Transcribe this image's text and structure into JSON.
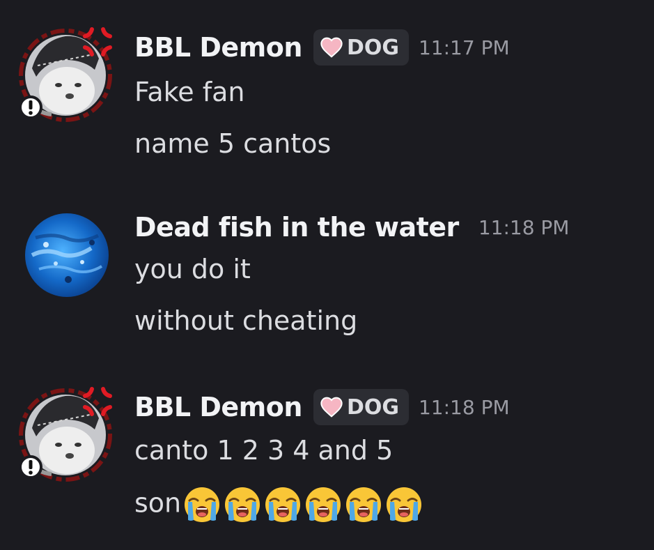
{
  "messages": [
    {
      "username": "BBL Demon",
      "tag": "DOG",
      "timestamp": "11:17 PM",
      "lines": [
        "Fake fan",
        "name 5 cantos"
      ],
      "avatar_icon": "seal-mugshot-avatar-with-anger-badge"
    },
    {
      "username": "Dead fish in the water",
      "timestamp": "11:18 PM",
      "lines": [
        "you do it",
        "without cheating"
      ],
      "avatar_icon": "blue-water-avatar"
    },
    {
      "username": "BBL Demon",
      "tag": "DOG",
      "timestamp": "11:18 PM",
      "lines": [
        "canto 1 2 3 4 and 5",
        "son"
      ],
      "avatar_icon": "seal-mugshot-avatar-with-anger-badge",
      "emojis": [
        "loudly-crying-face",
        "loudly-crying-face",
        "loudly-crying-face",
        "loudly-crying-face",
        "loudly-crying-face",
        "loudly-crying-face"
      ]
    }
  ],
  "colors": {
    "background": "#1b1b20",
    "username": "#f2f3f5",
    "text": "#dcdde1",
    "timestamp": "#9a9ba3",
    "tag_bg": "#2c2d33",
    "heart": "#f6b6c3"
  }
}
